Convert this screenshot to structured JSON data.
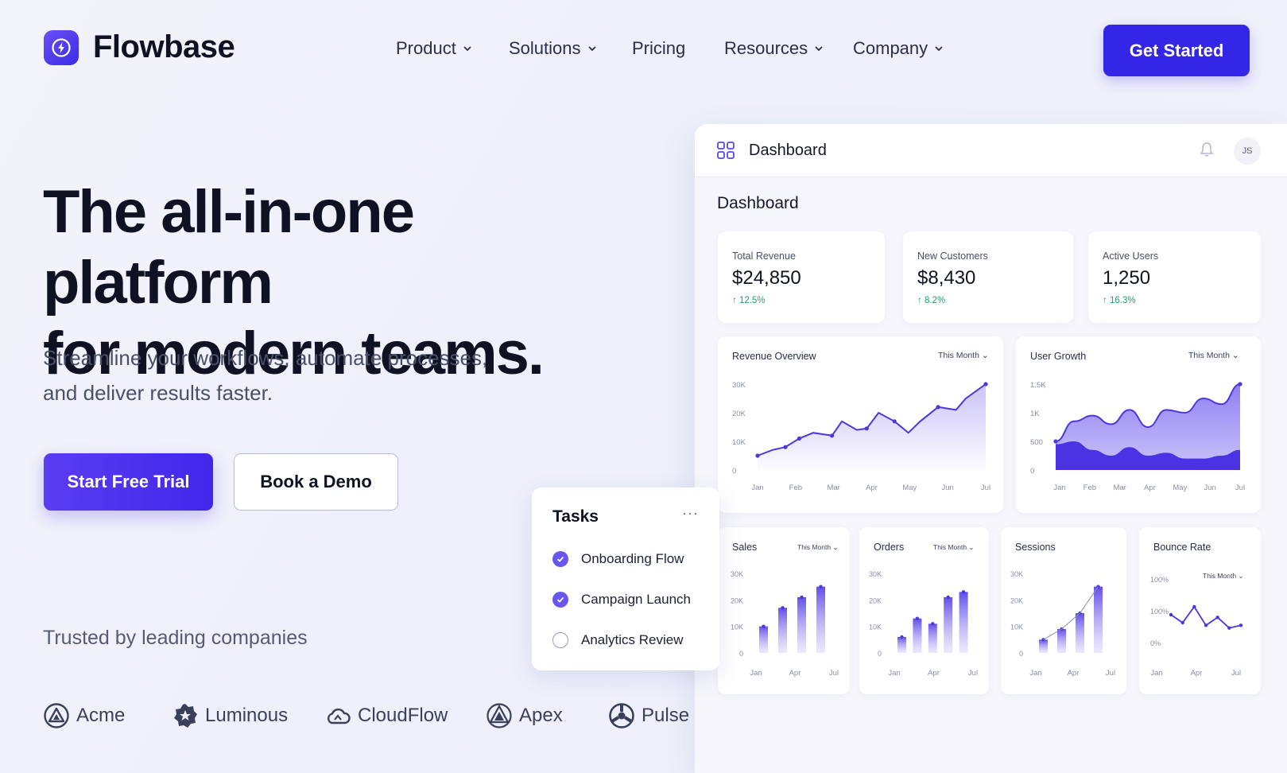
{
  "brand": {
    "name": "Flowbase",
    "logo_icon": "bolt-icon",
    "accent": "#3426e6"
  },
  "nav": {
    "items": [
      {
        "label": "Product",
        "has_menu": true
      },
      {
        "label": "Solutions",
        "has_menu": true
      },
      {
        "label": "Pricing",
        "has_menu": false
      },
      {
        "label": "Resources",
        "has_menu": true
      },
      {
        "label": "Company",
        "has_menu": true
      }
    ],
    "cta": "Get Started"
  },
  "hero": {
    "title_line1": "The all-in-one platform",
    "title_line2": "for modern teams.",
    "subtitle_line1": "Streamline your workflows, automate processes,",
    "subtitle_line2": "and deliver results faster.",
    "primary_button": "Start Free Trial",
    "secondary_button": "Book a Demo",
    "trusted_label": "Trusted by leading companies",
    "logos": [
      {
        "name": "Acme",
        "icon": "acme-logo-icon"
      },
      {
        "name": "Luminous",
        "icon": "luminous-logo-icon"
      },
      {
        "name": "CloudFlow",
        "icon": "cloudflow-logo-icon"
      },
      {
        "name": "Apex",
        "icon": "apex-logo-icon"
      },
      {
        "name": "Pulse",
        "icon": "pulse-logo-icon"
      }
    ]
  },
  "dashboard": {
    "app_title": "Dashboard",
    "avatar": "JS",
    "heading": "Dashboard",
    "kpis": [
      {
        "label": "Total Revenue",
        "value": "$24,850",
        "delta": "12.5%"
      },
      {
        "label": "New Customers",
        "value": "$8,430",
        "delta": "8.2%"
      },
      {
        "label": "Active Users",
        "value": "1,250",
        "delta": "16.3%"
      }
    ]
  },
  "tasks": {
    "title": "Tasks",
    "more": "···",
    "items": [
      {
        "label": "Onboarding Flow",
        "done": true
      },
      {
        "label": "Campaign Launch",
        "done": true
      },
      {
        "label": "Analytics Review",
        "done": false
      }
    ]
  },
  "chart_data": [
    {
      "type": "line",
      "title": "Revenue Overview",
      "selector": "This Month",
      "x": [
        "Jan",
        "Feb",
        "Mar",
        "Apr",
        "May",
        "Jun",
        "Jul"
      ],
      "y_ticks": [
        "30K",
        "20K",
        "10K",
        "0"
      ],
      "ylim": [
        0,
        30000
      ],
      "series": [
        {
          "values": [
            5000,
            7000,
            8000,
            11000,
            13000,
            12000,
            17000,
            14000,
            14500,
            20000,
            17000,
            13000,
            17000,
            22000,
            21000,
            25000,
            30000
          ],
          "x_pos": [
            0,
            0.15,
            0.28,
            0.42,
            0.56,
            0.75,
            0.85,
            1.0,
            1.1,
            1.22,
            1.38,
            1.52,
            1.64,
            1.82,
            2.0,
            2.1,
            2.3
          ]
        }
      ]
    },
    {
      "type": "area",
      "title": "User Growth",
      "selector": "This Month",
      "x": [
        "Jan",
        "Feb",
        "Mar",
        "Apr",
        "May",
        "Jun",
        "Jul"
      ],
      "y_ticks": [
        "1.5K",
        "1K",
        "500",
        "0"
      ],
      "ylim": [
        0,
        1500
      ],
      "series": [
        {
          "values": [
            500,
            850,
            950,
            800,
            1050,
            750,
            1050,
            1000,
            1250,
            1150,
            1500
          ]
        },
        {
          "values": [
            450,
            500,
            350,
            250,
            400,
            250,
            300,
            200,
            200,
            250,
            350
          ]
        }
      ]
    },
    {
      "type": "bar",
      "title": "Sales",
      "selector": "This Month",
      "x_ticks": [
        "Jan",
        "Apr",
        "Jul"
      ],
      "y_ticks": [
        "30K",
        "20K",
        "10K",
        "0"
      ],
      "ylim": [
        0,
        30000
      ],
      "values": [
        10000,
        17000,
        21000,
        25000
      ]
    },
    {
      "type": "bar",
      "title": "Orders",
      "selector": "This Month",
      "x_ticks": [
        "Jan",
        "Apr",
        "Jul"
      ],
      "y_ticks": [
        "30K",
        "20K",
        "10K",
        "0"
      ],
      "ylim": [
        0,
        30000
      ],
      "values": [
        6000,
        13000,
        11000,
        21000,
        23000
      ]
    },
    {
      "type": "bar",
      "title": "Sessions",
      "selector": "This Month",
      "x_ticks": [
        "Jan",
        "Apr",
        "Jul"
      ],
      "y_ticks": [
        "30K",
        "20K",
        "10K",
        "0"
      ],
      "ylim": [
        0,
        30000
      ],
      "values": [
        5000,
        9000,
        15000,
        25000
      ]
    },
    {
      "type": "line",
      "title": "Bounce Rate",
      "selector": "This Month",
      "x_ticks": [
        "Jan",
        "Apr",
        "Jul"
      ],
      "y_ticks": [
        "100%",
        "100%",
        "0%"
      ],
      "values": [
        45,
        30,
        60,
        25,
        40,
        20,
        25
      ]
    }
  ]
}
